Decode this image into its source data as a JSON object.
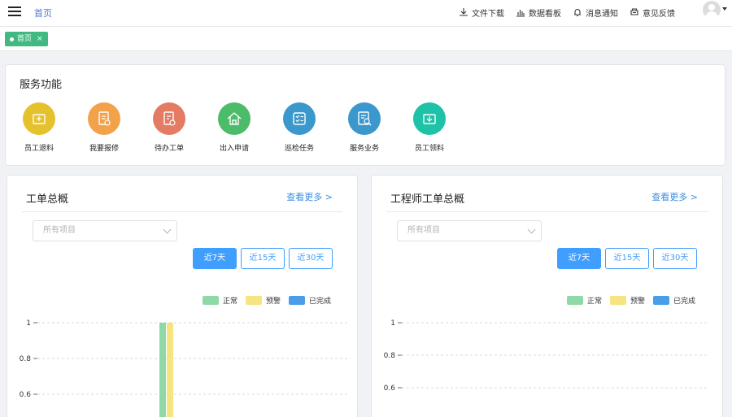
{
  "header": {
    "breadcrumb": "首页",
    "actions": [
      {
        "label": "文件下载",
        "icon": "download-icon"
      },
      {
        "label": "数据看板",
        "icon": "bar-chart-icon"
      },
      {
        "label": "消息通知",
        "icon": "bell-icon"
      },
      {
        "label": "意见反馈",
        "icon": "feedback-icon"
      }
    ]
  },
  "tabs": [
    {
      "label": "首页",
      "close": "×",
      "active": true
    }
  ],
  "services": {
    "title": "服务功能",
    "items": [
      {
        "label": "员工退料",
        "color": "#e5c22d",
        "icon": "return-material-icon"
      },
      {
        "label": "我要报修",
        "color": "#f2a24a",
        "icon": "repair-request-icon"
      },
      {
        "label": "待办工单",
        "color": "#e47b63",
        "icon": "todo-workorder-icon"
      },
      {
        "label": "出入申请",
        "color": "#4cbb6a",
        "icon": "access-request-icon"
      },
      {
        "label": "巡检任务",
        "color": "#3a98cc",
        "icon": "inspection-task-icon"
      },
      {
        "label": "服务业务",
        "color": "#3a98cc",
        "icon": "service-business-icon"
      },
      {
        "label": "员工领料",
        "color": "#1ec2a6",
        "icon": "collect-material-icon"
      }
    ]
  },
  "panels": [
    {
      "title": "工单总概",
      "more": "查看更多 >",
      "select_placeholder": "所有项目",
      "ranges": [
        "近7天",
        "近15天",
        "近30天"
      ],
      "active_range": "近7天",
      "legend": [
        {
          "label": "正常",
          "color": "#8fd9a8"
        },
        {
          "label": "预警",
          "color": "#f5e480"
        },
        {
          "label": "已完成",
          "color": "#4a9de8"
        }
      ]
    },
    {
      "title": "工程师工单总概",
      "more": "查看更多 >",
      "select_placeholder": "所有项目",
      "ranges": [
        "近7天",
        "近15天",
        "近30天"
      ],
      "active_range": "近7天",
      "legend": [
        {
          "label": "正常",
          "color": "#8fd9a8"
        },
        {
          "label": "预警",
          "color": "#f5e480"
        },
        {
          "label": "已完成",
          "color": "#4a9de8"
        }
      ]
    }
  ],
  "chart_data": [
    {
      "type": "bar",
      "ylim": [
        0,
        1
      ],
      "yticks": [
        "1",
        "0.8",
        "0.6"
      ],
      "grid": true,
      "legend_position": "top-right",
      "series": [
        {
          "name": "正常",
          "values": [
            1
          ]
        },
        {
          "name": "预警",
          "values": [
            1
          ]
        },
        {
          "name": "已完成",
          "values": [
            0
          ]
        }
      ]
    },
    {
      "type": "bar",
      "ylim": [
        0,
        1
      ],
      "yticks": [
        "1",
        "0.8",
        "0.6"
      ],
      "grid": true,
      "legend_position": "top-right",
      "series": [
        {
          "name": "正常",
          "values": []
        },
        {
          "name": "预警",
          "values": []
        },
        {
          "name": "已完成",
          "values": []
        }
      ]
    }
  ]
}
